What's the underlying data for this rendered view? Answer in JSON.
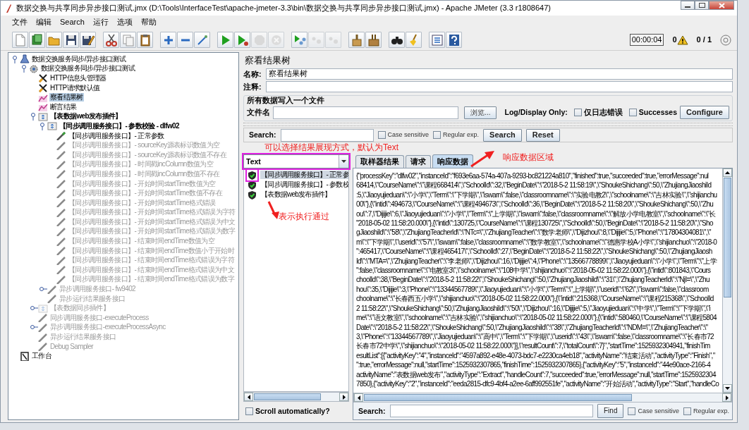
{
  "window": {
    "title": "数据交换与共享同步异步接口测试.jmx (D:\\Tools\\InterfaceTest\\apache-jmeter-3.3\\bin\\数据交换与共享同步异步接口测试.jmx) - Apache JMeter (3.3 r1808647)"
  },
  "menu": [
    "文件",
    "编辑",
    "Search",
    "运行",
    "选项",
    "帮助"
  ],
  "toolbar": [
    {
      "kind": "new",
      "disabled": false
    },
    {
      "kind": "templates",
      "disabled": false
    },
    {
      "kind": "open",
      "disabled": false
    },
    {
      "kind": "save",
      "disabled": false
    },
    {
      "kind": "save-as",
      "disabled": false
    },
    {
      "kind": "separator"
    },
    {
      "kind": "cut",
      "disabled": false
    },
    {
      "kind": "copy",
      "disabled": false
    },
    {
      "kind": "paste",
      "disabled": false
    },
    {
      "kind": "separator"
    },
    {
      "kind": "expand",
      "disabled": false
    },
    {
      "kind": "collapse",
      "disabled": false
    },
    {
      "kind": "toggle",
      "disabled": false
    },
    {
      "kind": "separator"
    },
    {
      "kind": "start",
      "disabled": false
    },
    {
      "kind": "start-no-pause",
      "disabled": false
    },
    {
      "kind": "stop",
      "disabled": true
    },
    {
      "kind": "shutdown",
      "disabled": true
    },
    {
      "kind": "separator"
    },
    {
      "kind": "remote-start",
      "disabled": false
    },
    {
      "kind": "remote-stop",
      "disabled": true
    },
    {
      "kind": "remote-exit",
      "disabled": true
    },
    {
      "kind": "separator"
    },
    {
      "kind": "clear",
      "disabled": false
    },
    {
      "kind": "clear-all",
      "disabled": false
    },
    {
      "kind": "separator"
    },
    {
      "kind": "search",
      "disabled": false
    },
    {
      "kind": "reset-search",
      "disabled": false
    },
    {
      "kind": "separator"
    },
    {
      "kind": "function-helper",
      "disabled": false
    },
    {
      "kind": "help",
      "disabled": false
    }
  ],
  "status": {
    "timer": "00:00:04",
    "warnings": "0",
    "threads": "0 / 1"
  },
  "test_plan_tree": [
    {
      "label": "数据交换服务同步/异步接口测试",
      "kind": "testplan",
      "selected": false,
      "disabled": false,
      "expanded": true,
      "children": [
        {
          "label": "数据交换服务同步/异步接口测试",
          "kind": "threadgroup",
          "selected": false,
          "disabled": false,
          "expanded": true,
          "children": [
            {
              "label": "HTTP信息头管理器",
              "kind": "config",
              "selected": false,
              "disabled": false
            },
            {
              "label": "HTTP请求默认值",
              "kind": "config",
              "selected": false,
              "disabled": false
            },
            {
              "label": "察看结果树",
              "kind": "listener",
              "selected": true,
              "disabled": false
            },
            {
              "label": "断言结果",
              "kind": "listener",
              "selected": false,
              "disabled": false
            },
            {
              "label": "【表数据web发布插件】",
              "kind": "controller",
              "selected": false,
              "disabled": false,
              "expanded": true,
              "children": [
                {
                  "label": "【同步调用服务接口】- 参数校验 - dlfw02",
                  "kind": "controller",
                  "selected": false,
                  "disabled": false,
                  "expanded": true,
                  "children": [
                    {
                      "label": "【同步调用服务接口】- 正常参数",
                      "kind": "sampler",
                      "selected": false,
                      "disabled": false
                    },
                    {
                      "label": "【同步调用服务接口】- sourceKey源表标识数值为空",
                      "kind": "sampler",
                      "selected": false,
                      "disabled": true
                    },
                    {
                      "label": "【同步调用服务接口】- sourceKey源表标识数值不存在",
                      "kind": "sampler",
                      "selected": false,
                      "disabled": true
                    },
                    {
                      "label": "【同步调用服务接口】- 时间戳incColumn数值为空",
                      "kind": "sampler",
                      "selected": false,
                      "disabled": true
                    },
                    {
                      "label": "【同步调用服务接口】- 时间戳incColumn数值不存在",
                      "kind": "sampler",
                      "selected": false,
                      "disabled": true
                    },
                    {
                      "label": "【同步调用服务接口】- 开始时间startTime数值为空",
                      "kind": "sampler",
                      "selected": false,
                      "disabled": true
                    },
                    {
                      "label": "【同步调用服务接口】- 开始时间startTime数值不存在",
                      "kind": "sampler",
                      "selected": false,
                      "disabled": true
                    },
                    {
                      "label": "【同步调用服务接口】- 开始时间startTime格式错误",
                      "kind": "sampler",
                      "selected": false,
                      "disabled": true
                    },
                    {
                      "label": "【同步调用服务接口】- 开始时间startTime格式错误为字符",
                      "kind": "sampler",
                      "selected": false,
                      "disabled": true
                    },
                    {
                      "label": "【同步调用服务接口】- 开始时间startTime格式错误为中文",
                      "kind": "sampler",
                      "selected": false,
                      "disabled": true
                    },
                    {
                      "label": "【同步调用服务接口】- 开始时间startTime格式错误为数字",
                      "kind": "sampler",
                      "selected": false,
                      "disabled": true
                    },
                    {
                      "label": "【同步调用服务接口】- 结束时间endTime数值为空",
                      "kind": "sampler",
                      "selected": false,
                      "disabled": true
                    },
                    {
                      "label": "【同步调用服务接口】- 结束时间endTime数值小于开始时",
                      "kind": "sampler",
                      "selected": false,
                      "disabled": true
                    },
                    {
                      "label": "【同步调用服务接口】- 结束时间endTime格式错误为字符",
                      "kind": "sampler",
                      "selected": false,
                      "disabled": true
                    },
                    {
                      "label": "【同步调用服务接口】- 结束时间endTime格式错误为中文",
                      "kind": "sampler",
                      "selected": false,
                      "disabled": true
                    },
                    {
                      "label": "【同步调用服务接口】- 结束时间endTime格式错误为数字",
                      "kind": "sampler",
                      "selected": false,
                      "disabled": true
                    }
                  ]
                },
                {
                  "label": "异步调用服务接口- fw9402",
                  "kind": "sampler",
                  "selected": false,
                  "disabled": true,
                  "expanded": false
                },
                {
                  "label": "异步运行结果服务接口",
                  "kind": "sampler",
                  "selected": false,
                  "disabled": true
                }
              ]
            },
            {
              "label": "【表数据同步插件】",
              "kind": "controller",
              "selected": false,
              "disabled": true,
              "expanded": false
            },
            {
              "label": "同步调用服务接口-executeProcess",
              "kind": "sampler",
              "selected": false,
              "disabled": true
            },
            {
              "label": "异步调用服务接口-executeProcessAsync",
              "kind": "sampler",
              "selected": false,
              "disabled": true,
              "expanded": false
            },
            {
              "label": "异步运行结果服务接口",
              "kind": "sampler",
              "selected": false,
              "disabled": true
            },
            {
              "label": "Debug Sampler",
              "kind": "sampler",
              "selected": false,
              "disabled": true
            }
          ]
        }
      ]
    },
    {
      "label": "工作台",
      "kind": "workbench",
      "selected": false,
      "disabled": false
    }
  ],
  "panel": {
    "title": "察看结果树",
    "name_field": {
      "label": "名称:",
      "value": "察看结果树"
    },
    "comment_field": {
      "label": "注释:"
    },
    "file_group": {
      "legend": "所有数据写入一个文件",
      "filename_label": "文件名",
      "browse_button": "浏览...",
      "log_label": "Log/Display Only:",
      "checkboxes": [
        {
          "label": "仅日志错误",
          "checked": false
        },
        {
          "label": "Successes",
          "checked": false
        }
      ],
      "configure_button": "Configure"
    },
    "search": {
      "label": "Search:",
      "checkboxes": [
        {
          "label": "Case sensitive",
          "checked": false
        },
        {
          "label": "Regular exp.",
          "checked": false
        }
      ],
      "buttons": [
        "Search",
        "Reset"
      ]
    },
    "renderer": {
      "value": "Text"
    },
    "results": [
      {
        "label": "【同步调用服务接口】- 正常参",
        "selected": true,
        "passed": true
      },
      {
        "label": "【同步调用服务接口】- 参数校",
        "selected": false,
        "passed": true
      },
      {
        "label": "【表数据web发布插件】",
        "selected": false,
        "passed": true
      }
    ],
    "scroll_auto": {
      "label": "Scroll automatically?",
      "checked": false
    },
    "tabs": [
      {
        "label": "取样器结果",
        "selected": false
      },
      {
        "label": "请求",
        "selected": false
      },
      {
        "label": "响应数据",
        "selected": true
      }
    ],
    "response_lines": [
      "{\"processKey\":\"dlfw02\",\"instanceId\":\"f693e6aa-574a-407a-9293-bc821224a810\",\"finished\":true,\"succeeded\":true,\"errorMessage\":nul",
      "68414,\\\"CourseName\\\":\\\"课程668414\\\",\\\"SchoolId\\\":32,\\\"BeginDate\\\":\\\"2018-5-2 11:58:19\\\",\\\"ShoukeShichang\\\":50,\\\"ZhujiangJiaoshiId",
      ":5,\\\"Jiaoyujieduan\\\":\\\"小学\\\",\\\"Term\\\":\\\"下学期\\\",\\\"iswarn\\\":false,\\\"classroomname\\\":\\\"实验电教2\\\",\\\"schoolname\\\":\\\"吉林实验\\\",\\\"shijianchu",
      "00\\\"},{\\\"intid\\\":494673,\\\"CourseName\\\":\\\"课程494673\\\",\\\"SchoolId\\\":36,\\\"BeginDate\\\":\\\"2018-5-2 11:58:20\\\",\\\"ShoukeShichang\\\":50,\\\"Zhu",
      "ou\\\":7,\\\"Dijijie\\\":6,\\\"Jiaoyujieduan\\\":\\\"小学\\\",\\\"Term\\\":\\\"上学期\\\",\\\"iswarn\\\":false,\\\"classroomname\\\":\\\"解放小学电教室\\\",\\\"schoolname\\\":\\\"长",
      "\"2018-05-02 11:58:20.000\\\"},{\\\"intid\\\":130725,\\\"CourseName\\\":\\\"课程130725\\\",\\\"SchoolId\\\":50,\\\"BeginDate\\\":\\\"2018-5-2 11:58:20\\\",\\\"Sho",
      "gJiaoshiId\\\":\\\"58\\\",\\\"ZhujiangTeacherId\\\":\\\"NTc=\\\",\\\"ZhujiangTeacher\\\":\\\"数学老师\\\",\\\"Dijizhou\\\":8,\\\"Dijijie\\\":5,\\\"Phone\\\":\\\"17804304081\\\",\\\"",
      "m\\\":\\\"下学期\\\",\\\"userid\\\":\\\"57\\\",\\\"iswarn\\\":false,\\\"classroomname\\\":\\\"数学教室\\\",\\\"schoolname\\\":\\\"德惠学校A小学\\\",\\\"shijianchuo\\\":\\\"2018-0",
      "\":465417,\\\"CourseName\\\":\\\"课程465417\\\",\\\"SchoolId\\\":27,\\\"BeginDate\\\":\\\"2018-5-2 11:58:22\\\",\\\"ShoukeShichang\\\":50,\\\"ZhujiangJiaosh",
      "Id\\\":\\\"MTA=\\\",\\\"ZhujiangTeacher\\\":\\\"李老师\\\",\\\"Dijizhou\\\":16,\\\"Dijijie\\\":4,\\\"Phone\\\":\\\"13566778899\\\",\\\"Jiaoyujieduan\\\":\\\"小学\\\",\\\"Term\\\":\\\"上学",
      "\":false,\\\"classroomname\\\":\\\"电教室3\\\",\\\"schoolname\\\":\\\"108中学\\\",\\\"shijianchuo\\\":\\\"2018-05-02 11:58:22.000\\\"},{\\\"intid\\\":801843,\\\"Cours",
      "choolId\\\":38,\\\"BeginDate\\\":\\\"2018-5-2 11:58:22\\\",\\\"ShoukeShichang\\\":50,\\\"ZhujiangJiaoshiId\\\":\\\"31\\\",\\\"ZhujiangTeacherId\\\":\\\"NjI=\\\",\\\"Zhu",
      "hou\\\":35,\\\"Dijijie\\\":3,\\\"Phone\\\":\\\"13344567789\\\",\\\"Jiaoyujieduan\\\":\\\"小学\\\",\\\"Term\\\":\\\"上学期\\\",\\\"userid\\\":\\\"62\\\",\\\"iswarn\\\":false,\\\"classroom",
      "choolname\\\":\\\"长春西五小学\\\",\\\"shijianchuo\\\":\\\"2018-05-02 11:58:22.000\\\"},{\\\"intid\\\":215368,\\\"CourseName\\\":\\\"课程215368\\\",\\\"SchoolId",
      "2 11:58:22\\\",\\\"ShoukeShichang\\\":50,\\\"ZhujiangJiaoshiId\\\":\\\"50\\\",\\\"Dijizhou\\\":16,\\\"Dijijie\\\":5,\\\"Jiaoyujieduan\\\":\\\"中学\\\",\\\"Term\\\":\\\"下学期\\\",\\\"i",
      "me\\\":\\\"语文教室\\\",\\\"schoolname\\\":\\\"吉林实验\\\",\\\"shijianchuo\\\":\\\"2018-05-02 11:58:22.000\\\"},{\\\"intid\\\":580460,\\\"CourseName\\\":\\\"课程5804",
      "Date\\\":\\\"2018-5-2 11:58:22\\\",\\\"ShoukeShichang\\\":50,\\\"ZhujiangJiaoshiId\\\":\\\"38\\\",\\\"ZhujiangTeacherId\\\":\\\"NDM=\\\",\\\"ZhujiangTeacher\\\":\\\"",
      "3,\\\"Phone\\\":\\\"13344567789\\\",\\\"Jiaoyujieduan\\\":\\\"高中\\\",\\\"Term\\\":\\\"下学期\\\",\\\"userid\\\":\\\"43\\\",\\\"iswarn\\\":false,\\\"classroomname\\\":\\\"长春市72",
      "长春市72中学\\\",\\\"shijianchuo\\\":\\\"2018-05-02 11:58:22.000\\\"}],\\\"resultCount\\\":7,\\\"totalCount\\\":7}\",\"startTime\":1525932304941,\"finishTim",
      "esultList\":[{\"activityKey\":\"4\",\"instanceId\":\"4597a892-e48e-4073-bdc7-e2230ca4eb18\",\"activityName\":\"结束活动\",\"activityType\":\"Finish\",\"",
      "\":true,\"errorMessage\":null,\"startTime\":1525932307865,\"finishTime\":1525932307865},{\"activityKey\":\"5\",\"instanceId\":\"44e90ace-2166-4",
      "activityName\":\"表数据web发布\",\"activityType\":\"Extract\",\"handleCount\":7,\"succeeded\":true,\"errorMessage\":null,\"startTime\":1525932304",
      "7850},{\"activityKey\":\"2\",\"instanceId\":\"eeda2815-dfc9-4bf4-a2ee-6aff992551fe\",\"activityName\":\"开始活动\",\"activityType\":\"Start\",\"handleCo"
    ],
    "bottom_search": {
      "label": "Search:",
      "button": "Find",
      "checkboxes": [
        {
          "label": "Case sensitive",
          "checked": false
        },
        {
          "label": "Regular exp.",
          "checked": false
        }
      ]
    }
  },
  "annotations": [
    {
      "kind": "note",
      "text": "可以选择结果展现方式，默认为Text"
    },
    {
      "kind": "note",
      "text": "响应数据区域"
    },
    {
      "kind": "note",
      "text": "表示执行通过"
    }
  ]
}
